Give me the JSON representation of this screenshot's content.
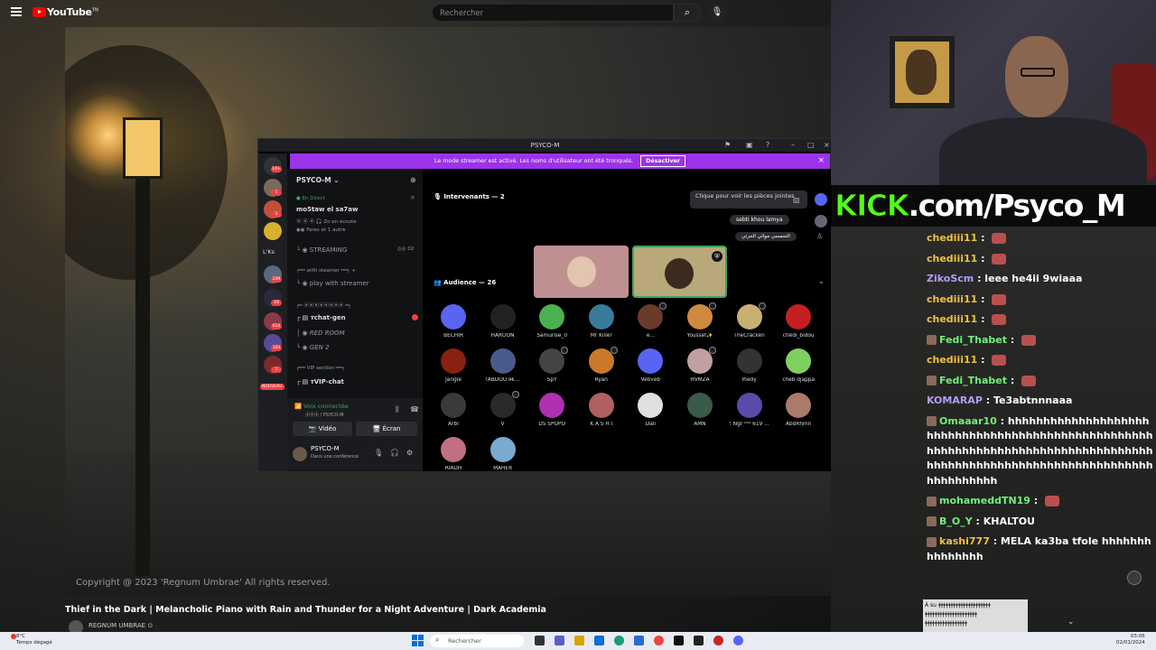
{
  "youtube": {
    "logo_text": "YouTube",
    "logo_sup": "TN",
    "search_placeholder": "Rechercher",
    "copyright": "Copyright @ 2023 'Regnum Umbrae' All rights reserved.",
    "video_title": "Thief in the Dark | Melancholic Piano with Rain and Thunder for a Night Adventure | Dark Academia",
    "channel_name": "REGNUM UMBRAE ⊙"
  },
  "discord": {
    "window_title": "PSYCO-M",
    "banner_text": "Le mode streamer est activé. Les noms d'utilisateur ont été tronqués.",
    "banner_button": "Désactiver",
    "server_name": "PSYCO-M",
    "live_label": "En Direct",
    "live_channel": "mo5taw el sa7aw",
    "live_listeners": "Zo en écoute",
    "live_friends": "Fares et 1 autre",
    "channels": [
      "STREAMING",
      "with steamer",
      "play with streamer",
      "тchat-gen",
      "RED ROOM",
      "GEN 2",
      "VIP section",
      "тVIP-chat"
    ],
    "streaming_count": "02",
    "voice_connected": "Voix connectée",
    "voice_channel": "PSYCO-M",
    "video_btn": "Vidéo",
    "screen_btn": "Écran",
    "user_name": "PSYCO-M",
    "user_status": "Dans une conférence",
    "speakers_label": "Intervenants — 2",
    "attach_tooltip": "Clique pour voir les pièces jointes",
    "mini_users": [
      "sebti khou lamya",
      "التحمسي موائي الحرتي"
    ],
    "audience_label": "Audience — 26",
    "audience": [
      "BECHIR",
      "HAROON",
      "Samurise_0",
      "Mr Killer",
      "e...",
      "Youssef✨",
      "TheCracken",
      "chedi_bidou",
      "Jangle",
      "!ABDOU я€...",
      "SpY",
      "Ryan",
      "Vebveb",
      "HVMZA",
      "Ihedy",
      "cheb djappa",
      "Arbi",
      "V",
      "DS SPOPO",
      "K A S H I",
      "Dali",
      "AMN",
      "! Ngr ᴸᴬᴰ 619 ...",
      "AbdRhmn",
      "RIADH",
      "MAHER"
    ],
    "servers": [
      {
        "badge": "14+"
      },
      {
        "badge": "1"
      },
      {
        "badge": "1"
      },
      {
        "badge": ""
      },
      {
        "label": "L'Ks"
      },
      {
        "badge": "249"
      },
      {
        "badge": "19"
      },
      {
        "badge": "614"
      },
      {
        "badge": "103"
      },
      {
        "badge": "1"
      },
      {
        "label": "NOUVEAU"
      }
    ]
  },
  "kick_banner": {
    "prefix": "KICK",
    "suffix": ".com/Psyco_M"
  },
  "chat": [
    {
      "user": "chediii11",
      "color": "#f0c040",
      "text": ""
    },
    {
      "user": "chediii11",
      "color": "#f0c040",
      "text": ""
    },
    {
      "user": "ZikoScm",
      "color": "#b59cf5",
      "text": "leee he4ii 9wiaaa"
    },
    {
      "user": "chediii11",
      "color": "#f0c040",
      "text": ""
    },
    {
      "user": "chediii11",
      "color": "#f0c040",
      "text": ""
    },
    {
      "user": "Fedi_Thabet",
      "color": "#6ff07a",
      "text": ""
    },
    {
      "user": "chediii11",
      "color": "#f0c040",
      "text": ""
    },
    {
      "user": "Fedi_Thabet",
      "color": "#6ff07a",
      "text": ""
    },
    {
      "user": "KOMARAP",
      "color": "#b59cf5",
      "text": "Te3abtnnnaaa"
    },
    {
      "user": "Omaaar10",
      "color": "#6ff07a",
      "text": "hhhhhhhhhhhhhhhhhhhhhhhhhhhhhhhhhhhhhhhhhhhhhhhhhhhhhhhhhhhhhhhhhhhhhhhhhhhhhhhhhhhhhhhhhhhhhhhhhhhhhhhhhhhhhhhhhhhhhhhhhhhhhh"
    },
    {
      "user": "mohameddTN19",
      "color": "#6ff07a",
      "text": ""
    },
    {
      "user": "B_O_Y",
      "color": "#6ff07a",
      "text": "KHALTOU"
    },
    {
      "user": "kashi777",
      "color": "#f0c040",
      "text": "MELA ka3ba tfole hhhhhhhhhhhhhhh"
    }
  ],
  "chat_bottom_text": "À su",
  "taskbar": {
    "search_placeholder": "Rechercher",
    "weather_temp": "8°C",
    "weather_desc": "Temps dégagé",
    "time": "03:06",
    "date": "02/01/2024"
  }
}
